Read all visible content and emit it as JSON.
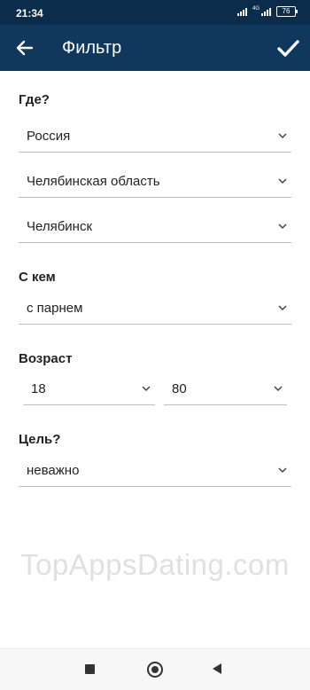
{
  "status_bar": {
    "time": "21:34",
    "network": "4G",
    "battery": "76"
  },
  "app_bar": {
    "title": "Фильтр",
    "back_icon": "arrow-left-icon",
    "confirm_icon": "check-icon"
  },
  "sections": {
    "where": {
      "label": "Где?",
      "country": "Россия",
      "region": "Челябинская область",
      "city": "Челябинск"
    },
    "with_whom": {
      "label": "С кем",
      "value": "с парнем"
    },
    "age": {
      "label": "Возраст",
      "from": "18",
      "to": "80"
    },
    "goal": {
      "label": "Цель?",
      "value": "неважно"
    }
  },
  "watermark": "TopAppsDating.com",
  "nav_bar": {
    "recent_icon": "square-icon",
    "home_icon": "circle-icon",
    "back_icon": "triangle-back-icon"
  },
  "colors": {
    "app_bar": "#10375c",
    "status_bar": "#0b2c4a",
    "divider": "#bdbdbd"
  }
}
